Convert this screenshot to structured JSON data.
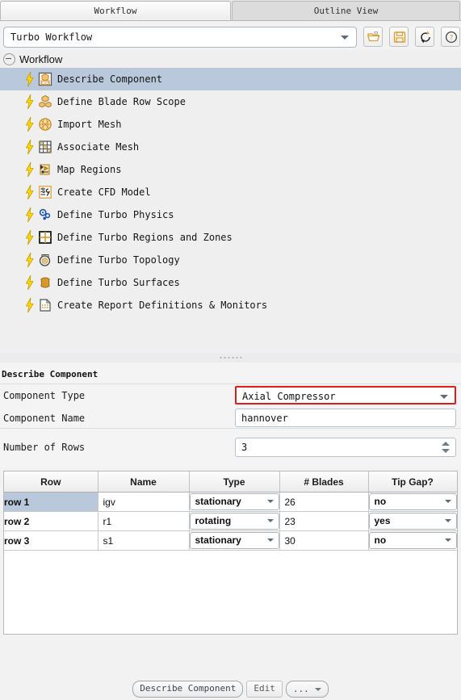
{
  "tabs": [
    {
      "label": "Workflow",
      "active": true
    },
    {
      "label": "Outline View",
      "active": false
    }
  ],
  "workflow_selector": {
    "value": "Turbo Workflow",
    "icon": "chevron-down-icon"
  },
  "toolbar": {
    "buttons": [
      {
        "name": "open-workflow-button",
        "icon": "folder-open-icon"
      },
      {
        "name": "save-workflow-button",
        "icon": "floppy-disk-icon"
      },
      {
        "name": "reset-workflow-button",
        "icon": "refresh-icon"
      },
      {
        "name": "help-button",
        "icon": "question-circle-icon"
      }
    ]
  },
  "tree": {
    "root_label": "Workflow",
    "items": [
      {
        "label": "Describe Component",
        "icon": "cad-box-icon",
        "selected": true
      },
      {
        "label": "Define Blade Row Scope",
        "icon": "blade-rows-icon",
        "selected": false
      },
      {
        "label": "Import Mesh",
        "icon": "mesh-globe-icon",
        "selected": false
      },
      {
        "label": "Associate Mesh",
        "icon": "mesh-grid-icon",
        "selected": false
      },
      {
        "label": "Map Regions",
        "icon": "map-regions-icon",
        "selected": false
      },
      {
        "label": "Create CFD Model",
        "icon": "cfd-wrench-icon",
        "selected": false
      },
      {
        "label": "Define Turbo Physics",
        "icon": "physics-gear-icon",
        "selected": false
      },
      {
        "label": "Define Turbo Regions and Zones",
        "icon": "regions-grid-icon",
        "selected": false
      },
      {
        "label": "Define Turbo Topology",
        "icon": "topology-disc-icon",
        "selected": false
      },
      {
        "label": "Define Turbo Surfaces",
        "icon": "surfaces-sheet-icon",
        "selected": false
      },
      {
        "label": "Create Report Definitions & Monitors",
        "icon": "report-page-icon",
        "selected": false
      }
    ]
  },
  "properties": {
    "section_title": "Describe Component",
    "component_type": {
      "label": "Component Type",
      "value": "Axial Compressor",
      "highlighted": true
    },
    "component_name": {
      "label": "Component Name",
      "value": "hannover"
    },
    "number_of_rows": {
      "label": "Number of Rows",
      "value": "3"
    }
  },
  "table": {
    "columns": [
      "Row",
      "Name",
      "Type",
      "# Blades",
      "Tip Gap?"
    ],
    "rows": [
      {
        "row": "row 1",
        "name": "igv",
        "type": "stationary",
        "blades": "26",
        "tip_gap": "no",
        "selected": true
      },
      {
        "row": "row 2",
        "name": "r1",
        "type": "rotating",
        "blades": "23",
        "tip_gap": "yes",
        "selected": false
      },
      {
        "row": "row 3",
        "name": "s1",
        "type": "stationary",
        "blades": "30",
        "tip_gap": "no",
        "selected": false
      }
    ]
  },
  "bottom_buttons": {
    "primary": "Describe Component",
    "edit": "Edit",
    "more": "..."
  },
  "colors": {
    "selection": "#b9c8da",
    "row_header": "#c6c6c6",
    "highlight_outline": "#e21c1c",
    "icon_gold": "#e8a33d",
    "bolt_yellow": "#ffdd00"
  }
}
